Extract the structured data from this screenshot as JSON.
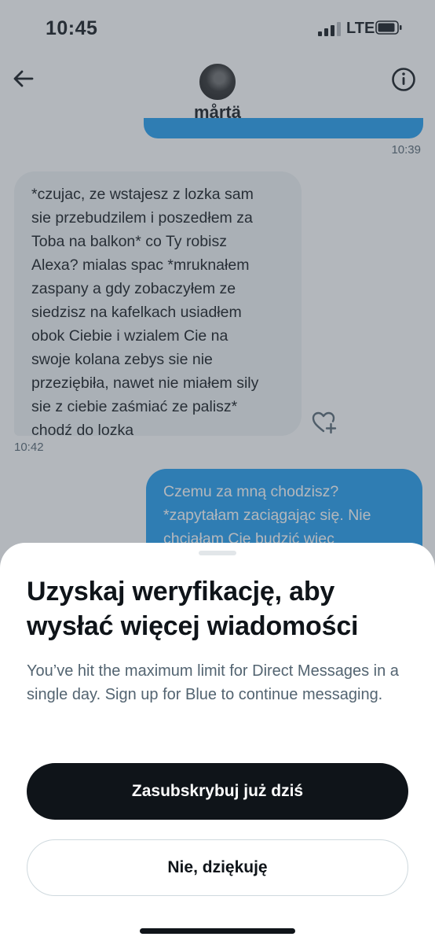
{
  "status_bar": {
    "time": "10:45",
    "network": "LTE"
  },
  "header": {
    "username": "mårtä"
  },
  "messages": [
    {
      "direction": "outgoing",
      "timestamp": "10:39"
    },
    {
      "direction": "incoming",
      "text": "*czujac, ze wstajesz z lozka sam\nsie przebudzilem i poszedłem za\nToba na balkon* co Ty robisz\nAlexa? mialas spac *mruknałem\nzaspany a gdy zobaczyłem ze\nsiedzisz na kafelkach usiadłem\nobok Ciebie i wzialem Cie na\nswoje kolana zebys sie nie\nprzeziębiła, nawet nie miałem sily\nsie z ciebie zaśmiać ze palisz*\nchodź do lozka",
      "timestamp": "10:42"
    },
    {
      "direction": "outgoing",
      "text": "Czemu za mną chodzisz?\n*zapytałam zaciągając się. Nie\nchciałam Cię budzić więc"
    }
  ],
  "sheet": {
    "title": "Uzyskaj weryfikację, aby wysłać więcej wiadomości",
    "body": "You’ve hit the maximum limit for Direct Messages in a single day. Sign up for Blue to continue messaging.",
    "primary_button": "Zasubskrybuj już dziś",
    "secondary_button": "Nie, dziękuję"
  },
  "icons": {
    "back": "arrow-left-icon",
    "info": "info-circle-icon",
    "reaction": "heart-plus-icon",
    "signal": "cellular-signal-icon",
    "battery": "battery-icon"
  },
  "colors": {
    "accent": "#1d9bf0",
    "text_primary": "#0f1419",
    "text_secondary": "#536471",
    "incoming_bubble": "#eff3f4",
    "primary_button": "#0f1419"
  }
}
